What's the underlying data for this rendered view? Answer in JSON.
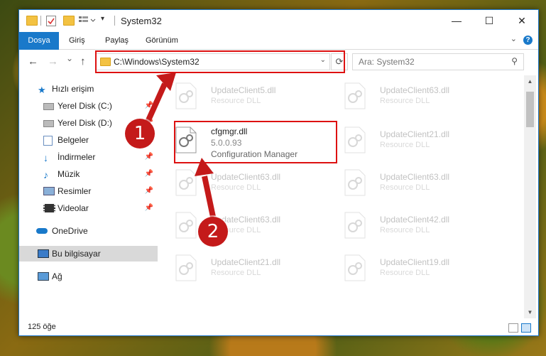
{
  "window": {
    "title": "System32",
    "minimize_glyph": "—",
    "maximize_glyph": "☐",
    "close_glyph": "✕"
  },
  "ribbon": {
    "tabs": [
      "Dosya",
      "Giriş",
      "Paylaş",
      "Görünüm"
    ],
    "help_glyph": "?"
  },
  "navigation": {
    "back_glyph": "←",
    "forward_glyph": "→",
    "recent_glyph": "⌄",
    "up_glyph": "↑",
    "address": "C:\\Windows\\System32",
    "search_placeholder": "Ara: System32",
    "refresh_glyph": "⟳"
  },
  "sidebar": {
    "items": [
      {
        "label": "Hızlı erişim",
        "icon": "star-icon"
      },
      {
        "label": "Yerel Disk (C:)",
        "icon": "drive-icon",
        "pinned": true
      },
      {
        "label": "Yerel Disk (D:)",
        "icon": "drive-icon",
        "pinned": true
      },
      {
        "label": "Belgeler",
        "icon": "documents-icon",
        "pinned": true
      },
      {
        "label": "İndirmeler",
        "icon": "downloads-icon",
        "pinned": true
      },
      {
        "label": "Müzik",
        "icon": "music-icon",
        "pinned": true
      },
      {
        "label": "Resimler",
        "icon": "pictures-icon",
        "pinned": true
      },
      {
        "label": "Videolar",
        "icon": "videos-icon",
        "pinned": true
      },
      {
        "label": "OneDrive",
        "icon": "cloud-icon"
      },
      {
        "label": "Bu bilgisayar",
        "icon": "computer-icon",
        "selected": true
      },
      {
        "label": "Ağ",
        "icon": "network-icon"
      }
    ]
  },
  "files": [
    {
      "name": "UpdateClient5.dll",
      "desc": "Resource DLL"
    },
    {
      "name": "UpdateClient63.dll",
      "desc": "Resource DLL"
    },
    {
      "name": "cfgmgr.dll",
      "version": "5.0.0.93",
      "desc": "Configuration Manager",
      "highlighted": true
    },
    {
      "name": "UpdateClient21.dll",
      "desc": "Resource DLL"
    },
    {
      "name": "UpdateClient63.dll",
      "desc": "Resource DLL"
    },
    {
      "name": "UpdateClient63.dll",
      "desc": "Resource DLL"
    },
    {
      "name": "UpdateClient63.dll",
      "desc": "Resource DLL"
    },
    {
      "name": "UpdateClient42.dll",
      "desc": "Resource DLL"
    },
    {
      "name": "UpdateClient21.dll",
      "desc": "Resource DLL"
    },
    {
      "name": "UpdateClient19.dll",
      "desc": "Resource DLL"
    }
  ],
  "status": {
    "item_count": "125 öğe"
  },
  "callouts": [
    "1",
    "2"
  ],
  "colors": {
    "accent": "#1979ca",
    "highlight": "#dd1111",
    "callout": "#c41a1a"
  }
}
